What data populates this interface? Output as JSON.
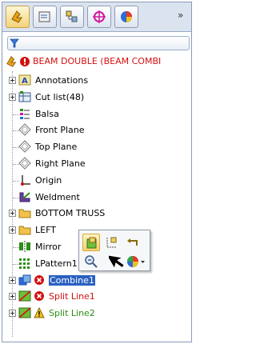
{
  "tabs": [
    {
      "name": "FeatureManager",
      "icon": "feature-manager-icon",
      "active": true
    },
    {
      "name": "PropertyManager",
      "icon": "property-manager-icon",
      "active": false
    },
    {
      "name": "ConfigurationManager",
      "icon": "configuration-manager-icon",
      "active": false
    },
    {
      "name": "DimXpertManager",
      "icon": "dimxpert-icon",
      "active": false
    },
    {
      "name": "DisplayManager",
      "icon": "display-manager-icon",
      "active": false
    }
  ],
  "more_tabs": "»",
  "tree": {
    "root_label": "BEAM DOUBLE  (BEAM COMBI",
    "items": [
      {
        "label": "Annotations",
        "icon": "annotations-icon",
        "color": "normal"
      },
      {
        "label": "Cut list(48)",
        "icon": "cut-list-icon",
        "color": "normal"
      },
      {
        "label": "Balsa",
        "icon": "material-icon",
        "color": "normal"
      },
      {
        "label": "Front Plane",
        "icon": "plane-icon",
        "color": "normal"
      },
      {
        "label": "Top Plane",
        "icon": "plane-icon",
        "color": "normal"
      },
      {
        "label": "Right Plane",
        "icon": "plane-icon",
        "color": "normal"
      },
      {
        "label": "Origin",
        "icon": "origin-icon",
        "color": "normal"
      },
      {
        "label": "Weldment",
        "icon": "weldment-icon",
        "color": "normal"
      },
      {
        "label": "BOTTOM TRUSS",
        "icon": "folder-icon",
        "color": "normal"
      },
      {
        "label": "LEFT",
        "icon": "folder-icon",
        "color": "normal"
      },
      {
        "label": "Mirror",
        "icon": "mirror-icon",
        "color": "normal"
      },
      {
        "label": "LPattern1",
        "icon": "linear-pattern-icon",
        "color": "normal"
      },
      {
        "label": "Combine1",
        "icon": "combine-icon",
        "color": "error-selected"
      },
      {
        "label": "Split Line1",
        "icon": "split-line-icon",
        "color": "error"
      },
      {
        "label": "Split Line2",
        "icon": "split-line-icon",
        "color": "warning"
      }
    ]
  },
  "popup_toolbar": {
    "buttons": [
      "edit-feature-icon",
      "edit-sketch-icon",
      "rollback-icon",
      "zoom-to-selection-icon",
      "appearance-icon"
    ]
  },
  "colors": {
    "error_text": "#d41010",
    "warning_text": "#2c8f16",
    "selection": "#2a5fc2"
  }
}
